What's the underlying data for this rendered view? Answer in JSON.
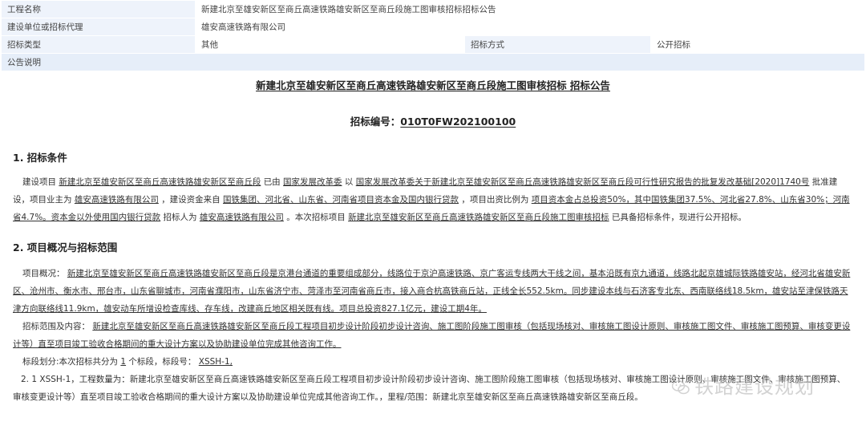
{
  "header": {
    "project_name_label": "工程名称",
    "project_name_value": "新建北京至雄安新区至商丘高速铁路雄安新区至商丘段施工图审核招标招标公告",
    "builder_label": "建设单位或招标代理",
    "builder_value": "雄安高速铁路有限公司",
    "bid_type_label": "招标类型",
    "bid_type_value": "其他",
    "bid_method_label": "招标方式",
    "bid_method_value": "公开招标",
    "notice_label": "公告说明"
  },
  "doc": {
    "title": "新建北京至雄安新区至商丘高速铁路雄安新区至商丘段施工图审核招标 招标公告",
    "code_label": "招标编号：",
    "code_value": "010T0FW202100100",
    "s1_heading": "1. 招标条件",
    "s1": {
      "t1": "建设项目",
      "v1": "新建北京至雄安新区至商丘高速铁路雄安新区至商丘段",
      "t2": "已由",
      "v2": "国家发展改革委",
      "t3": "以",
      "v3": "国家发展改革委关于新建北京至雄安新区至商丘高速铁路雄安新区至商丘段可行性研究报告的批复发改基础[2020]1740号",
      "t4": "批准建设，项目业主为",
      "v4": "雄安高速铁路有限公司",
      "t5": "，建设资金来自",
      "v5": "国铁集团、河北省、山东省、河南省项目资本金及国内银行贷款",
      "t6": "，项目出资比例为",
      "v6": "项目资本金占总投资50%，其中国铁集团37.5%、河北省27.8%、山东省30%；河南省4.7%。资本金以外使用国内银行贷款",
      "t7": "招标人为",
      "v7": "雄安高速铁路有限公司",
      "t8": "。本次招标项目",
      "v8": "新建北京至雄安新区至商丘高速铁路雄安新区至商丘段施工图审核招标",
      "t9": "已具备招标条件，现进行公开招标。"
    },
    "s2_heading": "2. 项目概况与招标范围",
    "s2": {
      "overview_label": "项目概况：",
      "overview_value": "新建北京至雄安新区至商丘高速铁路雄安新区至商丘段是京港台通道的重要组成部分，线路位于京沪高速铁路、京广客运专线两大干线之间，基本沿既有京九通道，线路北起京雄城际铁路雄安站，经河北省雄安新区、沧州市、衡水市、邢台市，山东省聊城市，河南省濮阳市，山东省济宁市、菏泽市至河南省商丘市，接入商合杭高铁商丘站，正线全长552.5km。同步建设本线与石济客专北东、西南联络线18.5km，雄安站至津保铁路天津方向联络线11.9km，雄安动车所增设检查库线、存车线，改建商丘地区相关既有线。项目总投资827.1亿元，建设工期4年。",
      "scope_label": "招标范围及内容：",
      "scope_value": "新建北京至雄安新区至商丘高速铁路雄安新区至商丘段工程项目初步设计阶段初步设计咨询、施工图阶段施工图审核（包括现场核对、审核施工图设计原则、审核施工图文件、审核施工图预算、审核变更设计等）直至项目竣工验收合格期间的重大设计方案以及协助建设单位完成其他咨询工作。",
      "split_label": "标段划分:本次招标共分为",
      "split_count": "1",
      "split_mid": "个标段，标段号：",
      "split_code": "XSSH-1,",
      "item_21": "2. 1  XSSH-1，工程数量为：新建北京至雄安新区至商丘高速铁路雄安新区至商丘段工程项目初步设计阶段初步设计咨询、施工图阶段施工图审核（包括现场核对、审核施工图设计原则、审核施工图文件、审核施工图预算、审核变更设计等）直至项目竣工验收合格期间的重大设计方案以及协助建设单位完成其他咨询工作。，里程/范围：新建北京至雄安新区至商丘高速铁路雄安新区至商丘段。"
    }
  },
  "watermark": {
    "text": "铁路建设规划",
    "icon": "wechat-icon"
  }
}
